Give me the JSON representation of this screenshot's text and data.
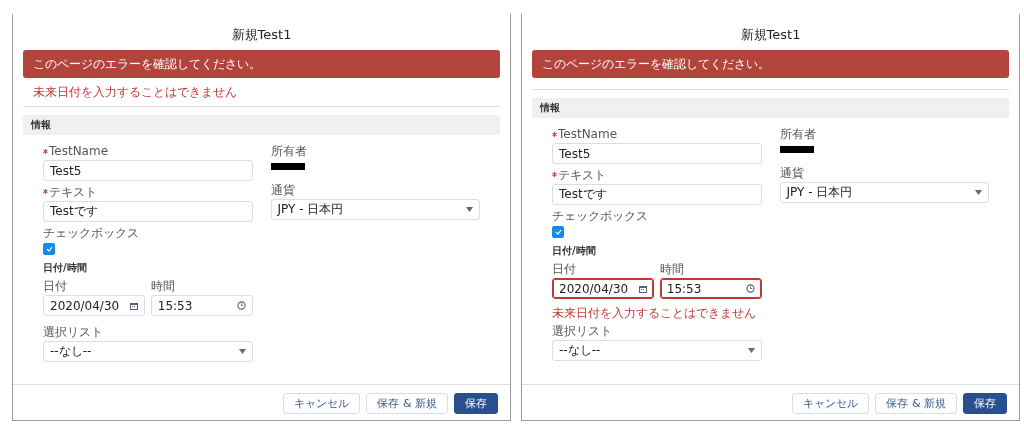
{
  "panels": [
    {
      "title": "新規Test1",
      "banner": "このページのエラーを確認してください。",
      "page_error": "未来日付を入力することはできません",
      "section": "情報",
      "fields": {
        "name": {
          "label": "TestName",
          "required": true,
          "value": "Test5"
        },
        "text": {
          "label": "テキスト",
          "required": true,
          "value": "Testです"
        },
        "checkbox": {
          "label": "チェックボックス",
          "checked": true
        },
        "datetime": {
          "label": "日付/時間",
          "date_label": "日付",
          "date": "2020/04/30",
          "time_label": "時間",
          "time": "15:53",
          "invalid": false
        },
        "picklist": {
          "label": "選択リスト",
          "value": "--なし--"
        },
        "owner": {
          "label": "所有者",
          "redacted": true
        },
        "currency": {
          "label": "通貨",
          "value": "JPY - 日本円"
        }
      },
      "buttons": [
        {
          "label": "キャンセル",
          "primary": false
        },
        {
          "label": "保存 & 新規",
          "primary": false
        },
        {
          "label": "保存",
          "primary": true
        }
      ]
    },
    {
      "title": "新規Test1",
      "banner": "このページのエラーを確認してください。",
      "section": "情報",
      "fields": {
        "name": {
          "label": "TestName",
          "required": true,
          "value": "Test5"
        },
        "text": {
          "label": "テキスト",
          "required": true,
          "value": "Testです"
        },
        "checkbox": {
          "label": "チェックボックス",
          "checked": true
        },
        "datetime": {
          "label": "日付/時間",
          "date_label": "日付",
          "date": "2020/04/30",
          "time_label": "時間",
          "time": "15:53",
          "invalid": true,
          "error": "未来日付を入力することはできません"
        },
        "picklist": {
          "label": "選択リスト",
          "value": "--なし--"
        },
        "owner": {
          "label": "所有者",
          "redacted": true
        },
        "currency": {
          "label": "通貨",
          "value": "JPY - 日本円"
        }
      },
      "buttons": [
        {
          "label": "キャンセル",
          "primary": false
        },
        {
          "label": "保存 & 新規",
          "primary": false
        },
        {
          "label": "保存",
          "primary": true
        }
      ]
    }
  ]
}
